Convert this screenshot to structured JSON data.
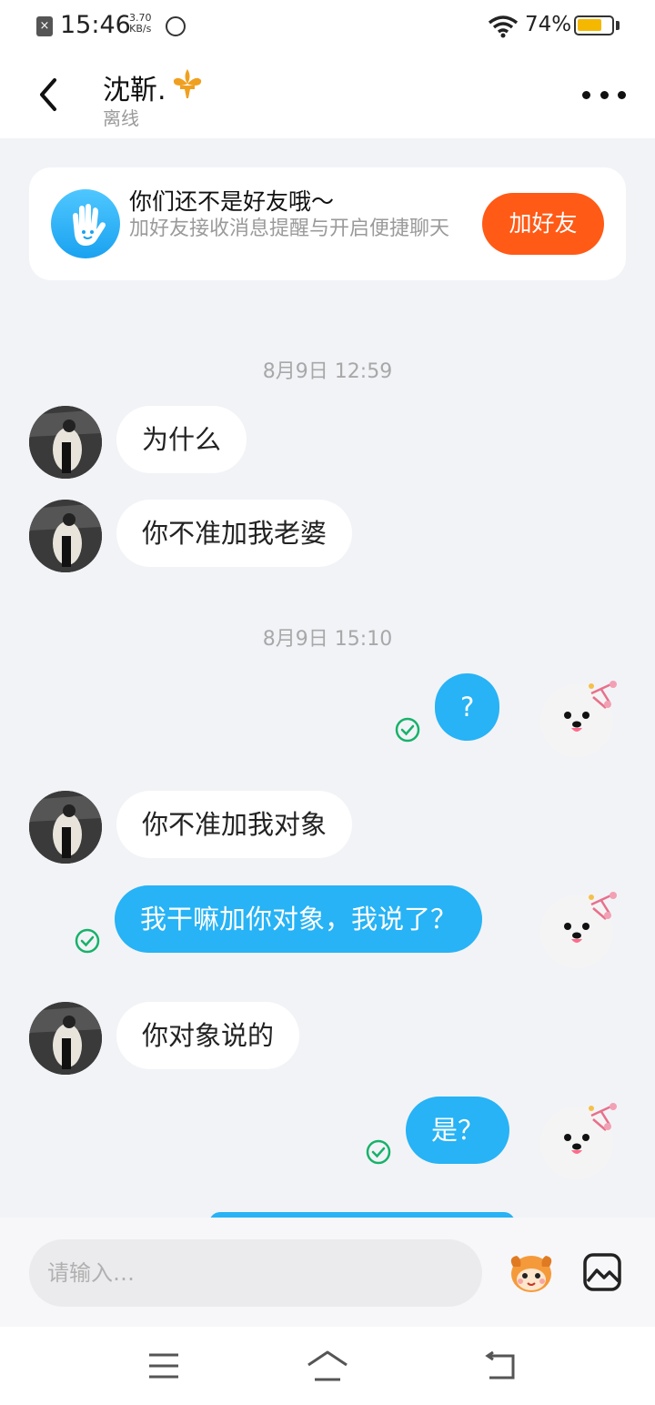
{
  "status_bar": {
    "time": "15:46",
    "net_speed_value": "3.70",
    "net_speed_unit": "KB/s",
    "battery_percent": "74%",
    "battery_level": 0.74
  },
  "header": {
    "contact_name": "沈靳.",
    "contact_status": "离线"
  },
  "friend_card": {
    "title": "你们还不是好友哦～",
    "description": "加好友接收消息提醒与开启便捷聊天",
    "button_label": "加好友"
  },
  "messages": [
    {
      "type": "timestamp",
      "text": "8月9日 12:59"
    },
    {
      "type": "incoming",
      "text": "为什么"
    },
    {
      "type": "incoming",
      "text": "你不准加我老婆"
    },
    {
      "type": "timestamp",
      "text": "8月9日 15:10"
    },
    {
      "type": "outgoing",
      "text": "?",
      "read": true
    },
    {
      "type": "incoming",
      "text": "你不准加我对象"
    },
    {
      "type": "outgoing",
      "text": "我干嘛加你对象，我说了？",
      "read": true
    },
    {
      "type": "incoming",
      "text": "你对象说的"
    },
    {
      "type": "outgoing",
      "text": "是？",
      "read": true
    }
  ],
  "input": {
    "placeholder": "请输入…"
  },
  "colors": {
    "accent_blue": "#27b3f5",
    "add_button_orange": "#ff5a16",
    "read_check_green": "#17b26a"
  },
  "icons": {
    "back": "chevron-left-icon",
    "more": "more-dots-icon",
    "emoji": "emoji-sticker-icon",
    "image": "image-icon"
  }
}
